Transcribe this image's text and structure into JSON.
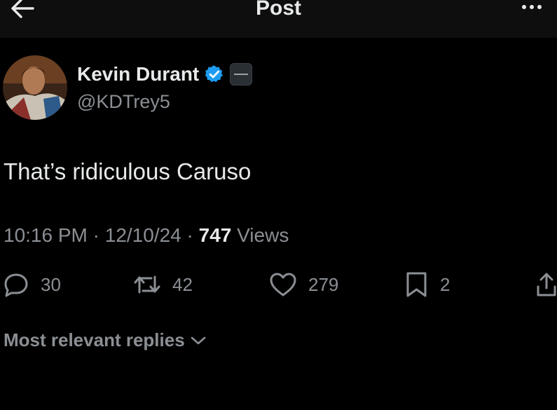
{
  "header": {
    "title": "Post",
    "back_icon": "arrow-left-icon",
    "more_icon": "more-horizontal-icon"
  },
  "author": {
    "display_name": "Kevin Durant",
    "handle": "@KDTrey5",
    "verified_icon": "verified-badge-icon",
    "verified_color": "#1d9bf0",
    "affiliation_icon": "affiliate-badge-icon"
  },
  "post": {
    "text": "That’s ridiculous Caruso",
    "time": "10:16 PM",
    "date": "12/10/24",
    "separator": "·",
    "views_count": "747",
    "views_label": "Views"
  },
  "actions": {
    "replies": {
      "icon": "reply-icon",
      "count": "30"
    },
    "reposts": {
      "icon": "repost-icon",
      "count": "42"
    },
    "likes": {
      "icon": "heart-icon",
      "count": "279"
    },
    "bookmarks": {
      "icon": "bookmark-icon",
      "count": "2"
    },
    "share": {
      "icon": "share-icon"
    }
  },
  "replies_sort": {
    "label": "Most relevant replies",
    "icon": "chevron-down-icon"
  },
  "colors": {
    "background": "#000000",
    "header_background": "#0e0e0e",
    "primary_text": "#e7e9ea",
    "secondary_text": "#8b8f94"
  }
}
